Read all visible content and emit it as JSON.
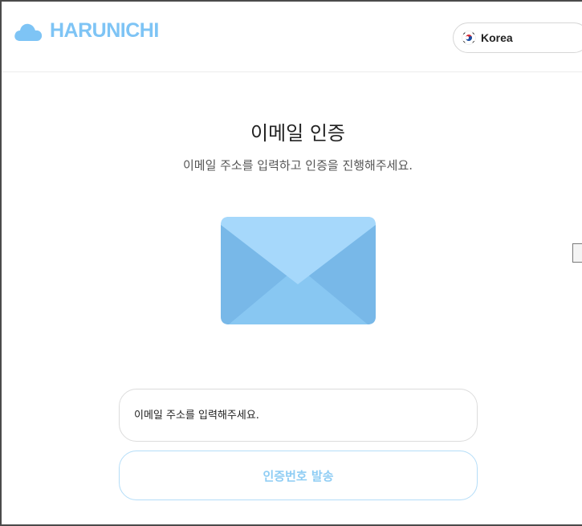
{
  "header": {
    "logo_text": "HARUNICHI",
    "language": {
      "selected": "Korea",
      "flag_icon": "korea-flag-icon"
    }
  },
  "main": {
    "title": "이메일 인증",
    "subtitle": "이메일 주소를 입력하고 인증을 진행해주세요.",
    "illustration_icon": "envelope-icon",
    "email_input": {
      "value": "",
      "placeholder": "이메일 주소를 입력해주세요."
    },
    "send_button_label": "인증번호 발송"
  },
  "colors": {
    "brand": "#7ec4f5",
    "envelope_light": "#a6d8fb",
    "envelope_mid": "#8ccaf4",
    "envelope_dark": "#76b6e6",
    "button_text": "#8fcdf4",
    "button_border": "#b4ddf8"
  }
}
